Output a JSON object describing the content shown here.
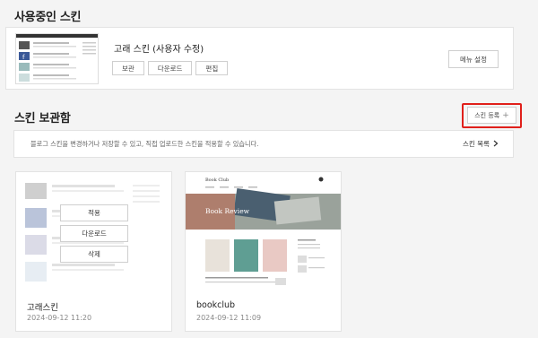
{
  "current_section": {
    "title": "사용중인 스킨",
    "skin_name": "고래 스킨 (사용자 수정)",
    "buttons": [
      "보관",
      "다운로드",
      "편집"
    ],
    "menu_button": "메뉴 설정"
  },
  "storage_section": {
    "title": "스킨 보관함",
    "register_button": "스킨 등록",
    "register_icon": "plus-icon",
    "info_text": "블로그 스킨을 변경하거나 저장할 수 있고, 직접 업로드한 스킨을 적용할 수 있습니다.",
    "list_link": "스킨 목록",
    "list_icon": "chevron-right-icon"
  },
  "skins": [
    {
      "name": "고래스킨",
      "date": "2024-09-12 11:20",
      "overlay_buttons": [
        "적용",
        "다운로드",
        "삭제"
      ]
    },
    {
      "name": "bookclub",
      "date": "2024-09-12 11:09",
      "preview": {
        "site_title": "Book Club",
        "banner_text": "Book Review"
      }
    }
  ],
  "colors": {
    "highlight": "#e0201b",
    "background": "#f4f4f4"
  }
}
